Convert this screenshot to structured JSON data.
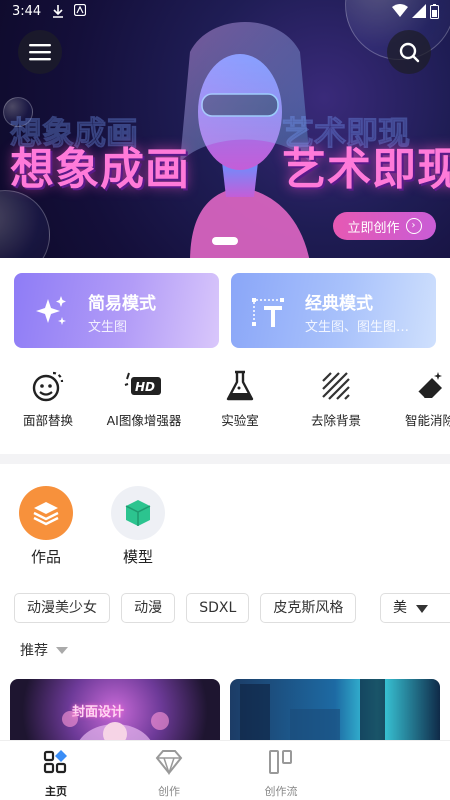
{
  "status_bar": {
    "time": "3:44"
  },
  "hero": {
    "title_left": "想象成画",
    "title_right": "艺术即现",
    "cta_label": "立即创作",
    "colors": {
      "pink": "#ff7ad9",
      "cta": "#e659b3"
    }
  },
  "modes": [
    {
      "title": "简易模式",
      "subtitle": "文生图",
      "icon": "sparkles-icon"
    },
    {
      "title": "经典模式",
      "subtitle": "文生图、图生图…",
      "icon": "text-transform-icon"
    }
  ],
  "tools": [
    {
      "label": "面部替换",
      "icon": "face-swap-icon"
    },
    {
      "label": "AI图像增强器",
      "icon": "hd-enhance-icon"
    },
    {
      "label": "实验室",
      "icon": "flask-icon"
    },
    {
      "label": "去除背景",
      "icon": "remove-background-icon"
    },
    {
      "label": "智能消除",
      "icon": "eraser-icon"
    }
  ],
  "quick": [
    {
      "label": "作品",
      "icon": "layers-icon",
      "color": "#f7913c"
    },
    {
      "label": "模型",
      "icon": "cube-icon",
      "color": "#2cc48f"
    }
  ],
  "tags": [
    "动漫美少女",
    "动漫",
    "SDXL",
    "皮克斯风格"
  ],
  "more_tag": "美",
  "sort_label": "推荐",
  "thumb1_title": "封面设计",
  "bottom_nav": [
    {
      "label": "主页",
      "icon": "home-icon",
      "active": true
    },
    {
      "label": "创作",
      "icon": "diamond-icon",
      "active": false
    },
    {
      "label": "创作流",
      "icon": "flow-icon",
      "active": false
    }
  ]
}
